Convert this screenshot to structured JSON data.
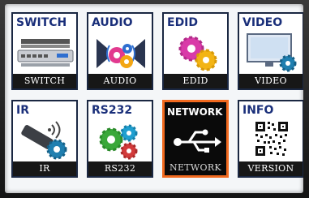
{
  "menu": {
    "items": [
      {
        "id": "switch",
        "header": "SWITCH",
        "label": "SWITCH",
        "icon": "switch-icon",
        "selected": false
      },
      {
        "id": "audio",
        "header": "AUDIO",
        "label": "AUDIO",
        "icon": "audio-gear-icon",
        "selected": false
      },
      {
        "id": "edid",
        "header": "EDID",
        "label": "EDID",
        "icon": "edid-gear-icon",
        "selected": false
      },
      {
        "id": "video",
        "header": "VIDEO",
        "label": "VIDEO",
        "icon": "video-monitor-icon",
        "selected": false
      },
      {
        "id": "ir",
        "header": "IR",
        "label": "IR",
        "icon": "ir-remote-icon",
        "selected": false
      },
      {
        "id": "rs232",
        "header": "RS232",
        "label": "RS232",
        "icon": "rs232-gear-icon",
        "selected": false
      },
      {
        "id": "network",
        "header": "NETWORK",
        "label": "NETWORK",
        "icon": "usb-network-icon",
        "selected": true
      },
      {
        "id": "info",
        "header": "INFO",
        "label": "VERSION",
        "icon": "qr-code-icon",
        "selected": false
      }
    ]
  },
  "colors": {
    "selection_border": "#f26a1f",
    "header_text": "#1a2f7a",
    "label_bar": "#171717"
  }
}
